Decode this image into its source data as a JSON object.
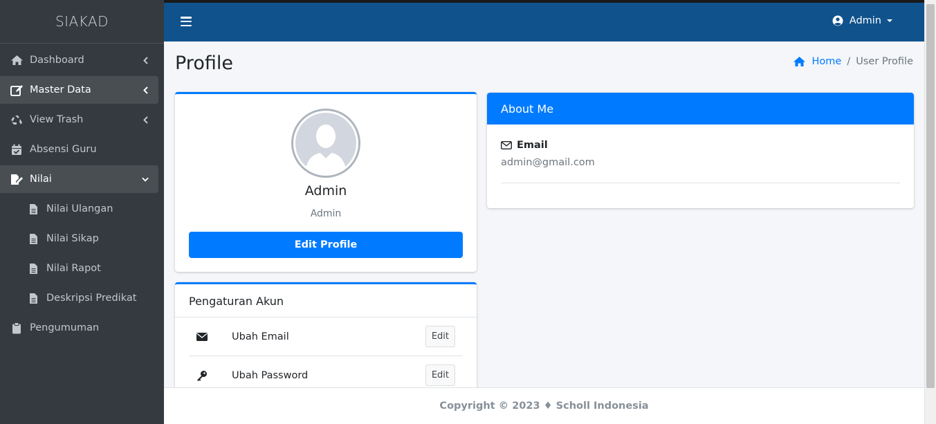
{
  "brand": "SIAKAD",
  "sidebar": {
    "items": [
      {
        "label": "Dashboard",
        "icon": "home-icon",
        "chevron": "chevron-left-icon"
      },
      {
        "label": "Master Data",
        "icon": "edit-icon",
        "chevron": "chevron-left-icon",
        "active": true
      },
      {
        "label": "View Trash",
        "icon": "recycle-icon",
        "chevron": "chevron-left-icon"
      },
      {
        "label": "Absensi Guru",
        "icon": "calendar-check-icon"
      },
      {
        "label": "Nilai",
        "icon": "signature-icon",
        "chevron": "chevron-down-icon",
        "active": true
      }
    ],
    "sub_items": [
      {
        "label": "Nilai Ulangan",
        "icon": "file-icon"
      },
      {
        "label": "Nilai Sikap",
        "icon": "file-icon"
      },
      {
        "label": "Nilai Rapot",
        "icon": "file-icon"
      },
      {
        "label": "Deskripsi Predikat",
        "icon": "file-icon"
      }
    ],
    "bottom_item": {
      "label": "Pengumuman",
      "icon": "clipboard-icon"
    }
  },
  "topbar": {
    "user_label": "Admin"
  },
  "page": {
    "title": "Profile",
    "breadcrumb": {
      "home": "Home",
      "separator": "/",
      "current": "User Profile"
    }
  },
  "profile_card": {
    "name": "Admin",
    "role": "Admin",
    "edit_button": "Edit Profile"
  },
  "account_card": {
    "title": "Pengaturan Akun",
    "rows": [
      {
        "label": "Ubah Email",
        "icon": "envelope-icon",
        "button": "Edit"
      },
      {
        "label": "Ubah Password",
        "icon": "key-icon",
        "button": "Edit"
      }
    ]
  },
  "about_card": {
    "title": "About Me",
    "email_label": "Email",
    "email_value": "admin@gmail.com"
  },
  "footer": {
    "text": "Copyright © 2023 ♦ Scholl Indonesia"
  },
  "colors": {
    "sidebar_bg": "#343a40",
    "topbar_bg": "#10528c",
    "primary": "#007bff",
    "content_bg": "#f4f6f9"
  }
}
